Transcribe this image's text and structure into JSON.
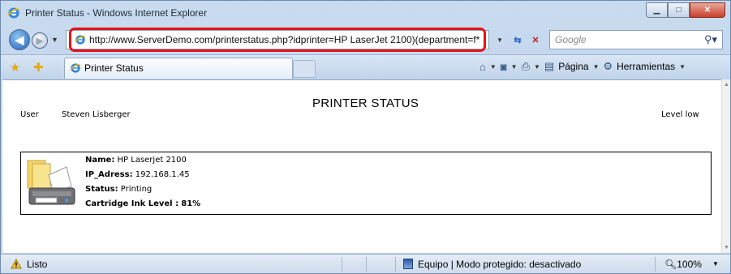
{
  "window": {
    "title": "Printer Status - Windows Internet Explorer",
    "min_icon": "minimize-icon",
    "max_icon": "maximize-icon",
    "close_icon": "close-icon"
  },
  "navigation": {
    "url": "http://www.ServerDemo.com/printerstatus.php?idprinter=HP LaserJet 2100)(department=f*",
    "search_placeholder": "Google",
    "highlight_color": "#e0131a"
  },
  "tabs": [
    {
      "label": "Printer Status",
      "active": true
    }
  ],
  "command_bar": {
    "page_label": "Página",
    "tools_label": "Herramientas"
  },
  "page": {
    "heading": "PRINTER STATUS",
    "user_label": "User",
    "user_name": "Steven Lisberger",
    "level_label": "Level low",
    "printer": {
      "name_label": "Name:",
      "name_value": "HP Laserjet 2100",
      "ip_label": "IP_Adress:",
      "ip_value": "192.168.1.45",
      "status_label": "Status:",
      "status_value": "Printing",
      "ink_label": "Cartridge Ink Level :",
      "ink_value": "81%"
    }
  },
  "statusbar": {
    "status": "Listo",
    "zone": "Equipo | Modo protegido: desactivado",
    "zoom": "100%"
  }
}
